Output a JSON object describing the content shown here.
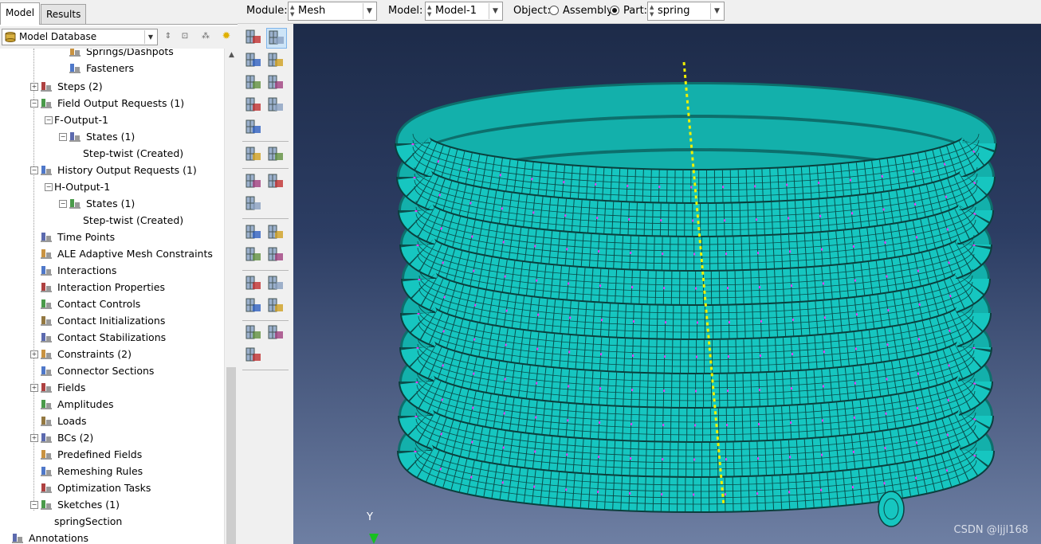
{
  "tabs": [
    {
      "label": "Model",
      "active": true
    },
    {
      "label": "Results",
      "active": false
    }
  ],
  "model_tree": {
    "database_label": "Model Database",
    "items": [
      {
        "label": "Springs/Dashpots",
        "icon": "springs-icon"
      },
      {
        "label": "Fasteners",
        "icon": "fasteners-icon"
      },
      {
        "label": "Steps (2)",
        "icon": "steps-icon"
      },
      {
        "label": "Field Output Requests (1)",
        "icon": "field-output-icon"
      },
      {
        "label": "F-Output-1",
        "icon": ""
      },
      {
        "label": "States (1)",
        "icon": "states-icon"
      },
      {
        "label": "Step-twist (Created)",
        "icon": ""
      },
      {
        "label": "History Output Requests (1)",
        "icon": "history-output-icon"
      },
      {
        "label": "H-Output-1",
        "icon": ""
      },
      {
        "label": "States (1)",
        "icon": "states-icon"
      },
      {
        "label": "Step-twist (Created)",
        "icon": ""
      },
      {
        "label": "Time Points",
        "icon": "time-points-icon"
      },
      {
        "label": "ALE Adaptive Mesh Constraints",
        "icon": "ale-icon"
      },
      {
        "label": "Interactions",
        "icon": "interactions-icon"
      },
      {
        "label": "Interaction Properties",
        "icon": "interaction-properties-icon"
      },
      {
        "label": "Contact Controls",
        "icon": "contact-controls-icon"
      },
      {
        "label": "Contact Initializations",
        "icon": "contact-init-icon"
      },
      {
        "label": "Contact Stabilizations",
        "icon": "contact-stab-icon"
      },
      {
        "label": "Constraints (2)",
        "icon": "constraints-icon"
      },
      {
        "label": "Connector Sections",
        "icon": "connector-icon"
      },
      {
        "label": "Fields",
        "icon": "fields-icon"
      },
      {
        "label": "Amplitudes",
        "icon": "amplitudes-icon"
      },
      {
        "label": "Loads",
        "icon": "loads-icon"
      },
      {
        "label": "BCs (2)",
        "icon": "bcs-icon"
      },
      {
        "label": "Predefined Fields",
        "icon": "predefined-icon"
      },
      {
        "label": "Remeshing Rules",
        "icon": "remeshing-icon"
      },
      {
        "label": "Optimization Tasks",
        "icon": "optimization-icon"
      },
      {
        "label": "Sketches (1)",
        "icon": "sketches-icon"
      },
      {
        "label": "springSection",
        "icon": ""
      },
      {
        "label": "Annotations",
        "icon": "annotations-icon"
      }
    ]
  },
  "context_bar": {
    "module_label": "Module:",
    "module_value": "Mesh",
    "model_label": "Model:",
    "model_value": "Model-1",
    "object_label": "Object:",
    "assembly_label": "Assembly",
    "part_label": "Part:",
    "part_value": "spring",
    "selected_object": "Part"
  },
  "toolbox_icons": [
    "seed-part-icon",
    "seed-edges-icon",
    "mesh-controls-icon",
    "element-type-icon",
    "mesh-part-icon",
    "delete-mesh-icon",
    "mesh-region-icon",
    "assign-stack-icon",
    "verify-mesh-icon",
    "partition-icon",
    "query-icon",
    "create-display-group-icon",
    "edit-mesh-icon",
    "adaptive-remesh-icon",
    "transform-mesh-icon",
    "virtual-topology-icon",
    "repair-icon",
    "datum-point-icon",
    "datum-axis-icon",
    "datum-plane-icon",
    "datum-csys-icon",
    "part-edit-icon",
    "merge-icon",
    "geometry-edit-icon",
    "tools-icon"
  ],
  "viewport": {
    "triad_label": "Y",
    "watermark": "CSDN @ljjl168"
  },
  "colors": {
    "mesh_fill": "#16c6c0",
    "seed_marks": "#ff33ff",
    "axis_line": "#f0f000",
    "viewport_top": "#1d2b49",
    "viewport_bottom": "#6e7fa3"
  }
}
